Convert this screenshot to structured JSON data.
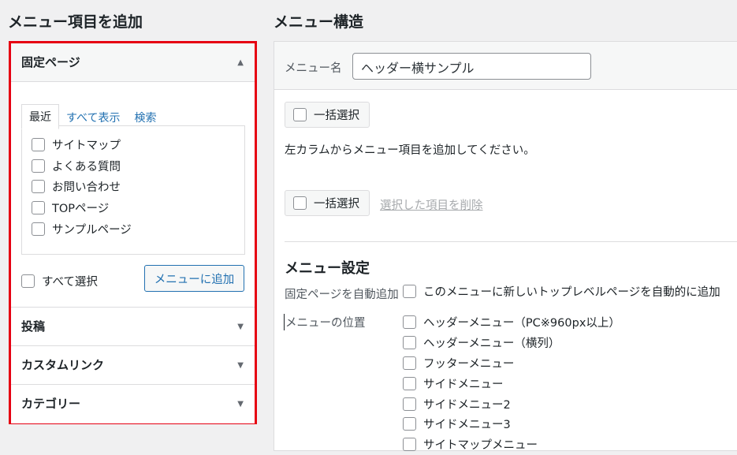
{
  "left": {
    "title": "メニュー項目を追加",
    "pages": {
      "label": "固定ページ",
      "tabs": [
        "最近",
        "すべて表示",
        "検索"
      ],
      "items": [
        "サイトマップ",
        "よくある質問",
        "お問い合わせ",
        "TOPページ",
        "サンプルページ"
      ],
      "select_all": "すべて選択",
      "add_button": "メニューに追加"
    },
    "sections": [
      "投稿",
      "カスタムリンク",
      "カテゴリー"
    ],
    "arrow_up": "▲",
    "arrow_down": "▼"
  },
  "right": {
    "title": "メニュー構造",
    "menu_name_label": "メニュー名",
    "menu_name_value": "ヘッダー横サンプル",
    "bulk_select": "一括選択",
    "instruction": "左カラムからメニュー項目を追加してください。",
    "delete_selected": "選択した項目を削除",
    "settings": {
      "title": "メニュー設定",
      "auto_add_label": "固定ページを自動追加",
      "auto_add_option": "このメニューに新しいトップレベルページを自動的に追加",
      "location_label": "メニューの位置",
      "locations": [
        "ヘッダーメニュー（PC※960px以上）",
        "ヘッダーメニュー（横列）",
        "フッターメニュー",
        "サイドメニュー",
        "サイドメニュー2",
        "サイドメニュー3",
        "サイトマップメニュー"
      ]
    }
  }
}
